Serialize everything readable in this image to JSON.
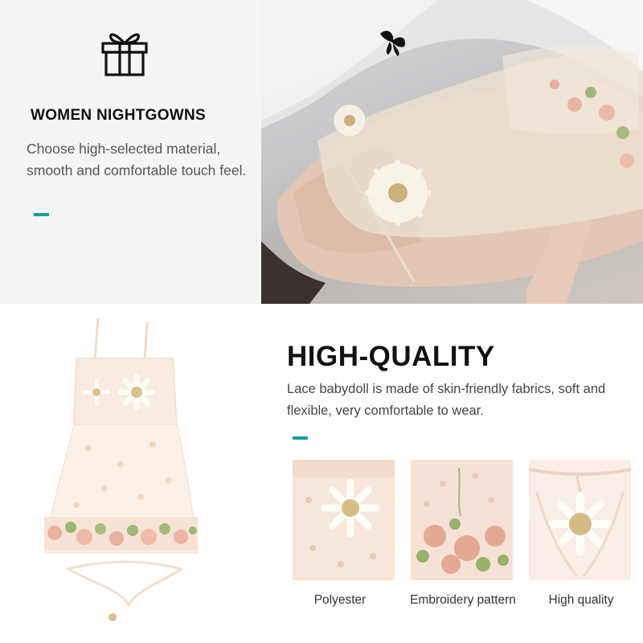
{
  "intro": {
    "icon": "gift-icon",
    "title": "WOMEN NIGHTGOWNS",
    "description": "Choose high-selected material, smooth and comfortable touch feel.",
    "accent_color": "#1a9c94"
  },
  "feature": {
    "title": "HIGH-QUALITY",
    "description": "Lace babydoll is made of skin-friendly fabrics, soft and flexible, very comfortable to wear.",
    "accent_color": "#1a9c94"
  },
  "details": [
    {
      "label": "Polyester"
    },
    {
      "label": "Embroidery pattern"
    },
    {
      "label": "High quality"
    }
  ]
}
